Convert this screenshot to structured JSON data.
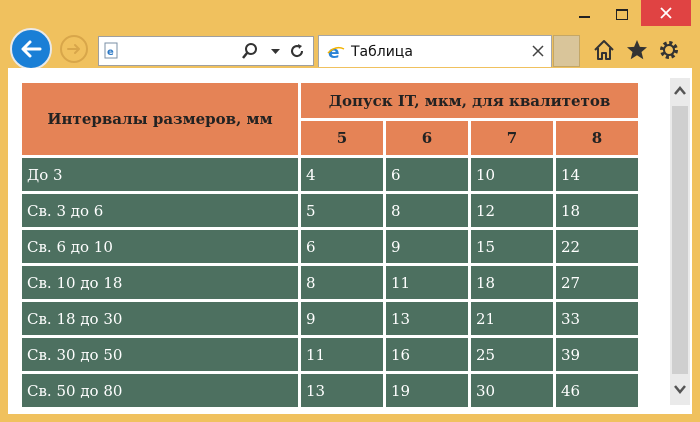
{
  "window": {
    "minimize": "minimize",
    "maximize": "maximize",
    "close": "close"
  },
  "toolbar": {
    "address_value": "",
    "tab_title": "Таблица"
  },
  "table": {
    "header_range": "Интервалы размеров, мм",
    "header_tolerance": "Допуск IT, мкм, для квалитетов",
    "grades": [
      "5",
      "6",
      "7",
      "8"
    ],
    "rows": [
      {
        "range": "До 3",
        "values": [
          "4",
          "6",
          "10",
          "14"
        ]
      },
      {
        "range": "Св. 3 до 6",
        "values": [
          "5",
          "8",
          "12",
          "18"
        ]
      },
      {
        "range": "Св. 6 до 10",
        "values": [
          "6",
          "9",
          "15",
          "22"
        ]
      },
      {
        "range": "Св. 10 до 18",
        "values": [
          "8",
          "11",
          "18",
          "27"
        ]
      },
      {
        "range": "Св. 18 до 30",
        "values": [
          "9",
          "13",
          "21",
          "33"
        ]
      },
      {
        "range": "Св. 30 до 50",
        "values": [
          "11",
          "16",
          "25",
          "39"
        ]
      },
      {
        "range": "Св. 50 до 80",
        "values": [
          "13",
          "19",
          "30",
          "46"
        ]
      }
    ]
  },
  "colors": {
    "frame": "#f0c15e",
    "header_bg": "#e58356",
    "cell_bg": "#4d7060",
    "back_button": "#1a7fd6",
    "close_button": "#e04343"
  }
}
